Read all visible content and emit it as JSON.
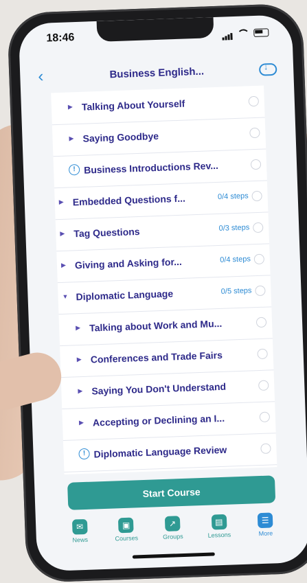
{
  "status": {
    "time": "18:46"
  },
  "header": {
    "title": "Business English..."
  },
  "lessons": [
    {
      "label": "Talking About Yourself",
      "kind": "topic",
      "indent": 2,
      "steps": ""
    },
    {
      "label": "Saying Goodbye",
      "kind": "topic",
      "indent": 2,
      "steps": ""
    },
    {
      "label": "Business Introductions Rev...",
      "kind": "quiz",
      "indent": 2,
      "steps": ""
    },
    {
      "label": "Embedded Questions f...",
      "kind": "lesson",
      "indent": 1,
      "steps": "0/4 steps"
    },
    {
      "label": "Tag Questions",
      "kind": "lesson",
      "indent": 1,
      "steps": "0/3 steps"
    },
    {
      "label": "Giving and Asking for...",
      "kind": "lesson",
      "indent": 1,
      "steps": "0/4 steps"
    },
    {
      "label": "Diplomatic Language",
      "kind": "lesson-open",
      "indent": 1,
      "steps": "0/5 steps"
    },
    {
      "label": "Talking about Work and Mu...",
      "kind": "topic",
      "indent": 2,
      "steps": ""
    },
    {
      "label": "Conferences and Trade Fairs",
      "kind": "topic",
      "indent": 2,
      "steps": ""
    },
    {
      "label": "Saying You Don't Understand",
      "kind": "topic",
      "indent": 2,
      "steps": ""
    },
    {
      "label": "Accepting or Declining an I...",
      "kind": "topic",
      "indent": 2,
      "steps": ""
    },
    {
      "label": "Diplomatic Language Review",
      "kind": "quiz",
      "indent": 2,
      "steps": ""
    }
  ],
  "actions": {
    "start_label": "Start Course"
  },
  "tabs": [
    {
      "label": "News",
      "icon": "news-icon"
    },
    {
      "label": "Courses",
      "icon": "courses-icon"
    },
    {
      "label": "Groups",
      "icon": "groups-icon"
    },
    {
      "label": "Lessons",
      "icon": "lessons-icon"
    },
    {
      "label": "More",
      "icon": "more-icon",
      "active": true
    }
  ]
}
